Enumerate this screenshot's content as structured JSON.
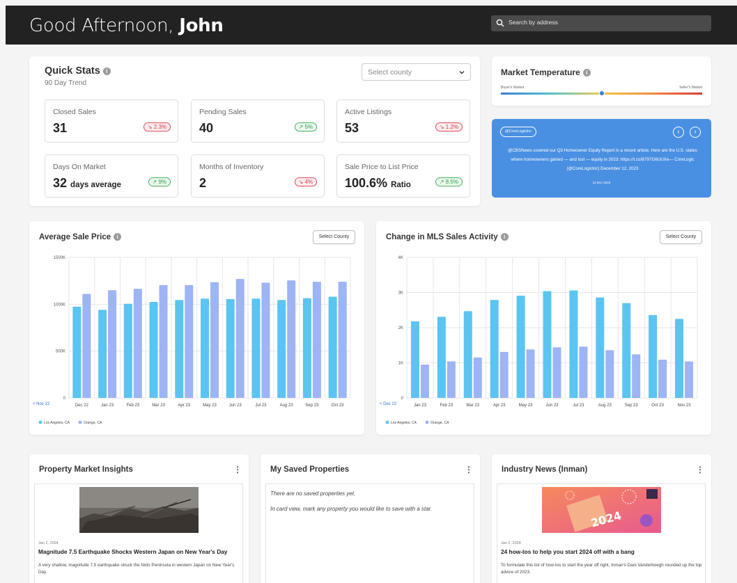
{
  "header": {
    "greeting_prefix": "Good Afternoon,",
    "greeting_name": "John",
    "search_placeholder": "Search by address"
  },
  "quick_stats": {
    "title": "Quick Stats",
    "subtitle": "90 Day Trend",
    "county_select": "Select county",
    "stats": [
      {
        "label": "Closed Sales",
        "value": "31",
        "unit": "",
        "change": "2.3%",
        "direction": "down"
      },
      {
        "label": "Pending Sales",
        "value": "40",
        "unit": "",
        "change": "5%",
        "direction": "up"
      },
      {
        "label": "Active Listings",
        "value": "53",
        "unit": "",
        "change": "1.2%",
        "direction": "down"
      },
      {
        "label": "Days On Market",
        "value": "32",
        "unit": "days average",
        "change": "9%",
        "direction": "up"
      },
      {
        "label": "Months of Inventory",
        "value": "2",
        "unit": "",
        "change": "4%",
        "direction": "down"
      },
      {
        "label": "Sale Price to List Price",
        "value": "100.6%",
        "unit": "Ratio",
        "change": "8.5%",
        "direction": "up"
      }
    ]
  },
  "market_temperature": {
    "title": "Market Temperature",
    "left_label": "Buyer's Market",
    "right_label": "Seller's Market",
    "level": 0.5
  },
  "tweet": {
    "tag": "@CoreLogicInc",
    "prev": "‹",
    "next": "›",
    "text": "@CBSNews covered our Q3 Homeowner Equity Report in a recent article. Here are the U.S. states where homeowners gained — and lost — equity in 2023: https://t.co/B797G6UUXe— CoreLogic (@CoreLogicInc) December 12, 2023",
    "date": "12 Dec 2023"
  },
  "colors": {
    "series1": "#5bc4f1",
    "series2": "#9db4f5",
    "down": "#e04a58",
    "up": "#3fb55b",
    "tweet_bg": "#4a90e2",
    "topbar": "#222222"
  },
  "avg_sale_chart": {
    "title": "Average Sale Price",
    "button": "Select County",
    "prev_label": "< Nov 22",
    "chart_data": {
      "type": "bar",
      "categories": [
        "Dec 22",
        "Jan 23",
        "Feb 23",
        "Mar 23",
        "Apr 23",
        "May 23",
        "Jun 23",
        "Jul 23",
        "Aug 23",
        "Sep 23",
        "Oct 23"
      ],
      "series": [
        {
          "name": "Los Angeles, CA",
          "values": [
            975,
            940,
            1005,
            1025,
            1045,
            1060,
            1055,
            1060,
            1045,
            1065,
            1080
          ]
        },
        {
          "name": "Orange, CA",
          "values": [
            1110,
            1150,
            1165,
            1205,
            1205,
            1235,
            1270,
            1230,
            1255,
            1240,
            1240
          ]
        }
      ],
      "ylim": [
        0,
        1500
      ],
      "yticks": [
        "0",
        "500K",
        "1000K",
        "1500K"
      ],
      "ytick_values": [
        0,
        500,
        1000,
        1500
      ]
    }
  },
  "mls_chart": {
    "title": "Change in MLS Sales Activity",
    "button": "Select County",
    "prev_label": "< Dec 22",
    "chart_data": {
      "type": "bar",
      "categories": [
        "Jan 23",
        "Feb 23",
        "Mar 23",
        "Apr 23",
        "May 23",
        "Jun 23",
        "Jul 23",
        "Aug 23",
        "Sep 23",
        "Oct 23",
        "Nov 23"
      ],
      "series": [
        {
          "name": "Los Angeles, CA",
          "values": [
            2180,
            2310,
            2470,
            2790,
            2910,
            3040,
            3060,
            2860,
            2700,
            2360,
            2250
          ]
        },
        {
          "name": "Orange, CA",
          "values": [
            950,
            1040,
            1150,
            1310,
            1380,
            1440,
            1460,
            1360,
            1240,
            1090,
            1040
          ]
        }
      ],
      "ylim": [
        0,
        4000
      ],
      "yticks": [
        "0",
        "1K",
        "2K",
        "3K",
        "4K"
      ],
      "ytick_values": [
        0,
        1000,
        2000,
        3000,
        4000
      ]
    }
  },
  "insights": {
    "title": "Property Market Insights",
    "date": "Jan 2, 2024",
    "headline": "Magnitude 7.5 Earthquake Shocks Western Japan on New Year's Day",
    "body": "A very shallow, magnitude 7.5 earthquake struck the Noto Peninsula in western Japan on New Year's Day."
  },
  "saved": {
    "title": "My Saved Properties",
    "line1": "There are no saved properties yet.",
    "line2": "In card view, mark any property you would like to save with a star."
  },
  "news": {
    "title": "Industry News (Inman)",
    "date": "Jan 2, 2024",
    "headline": "24 how-tos to help you start 2024 off with a bang",
    "body": "To formulate this list of how-tos to start the year off right, Inman's Dani Vanderboegh rounded up the top advice of 2023.",
    "image_text": "2024"
  },
  "kebab": "⋮"
}
